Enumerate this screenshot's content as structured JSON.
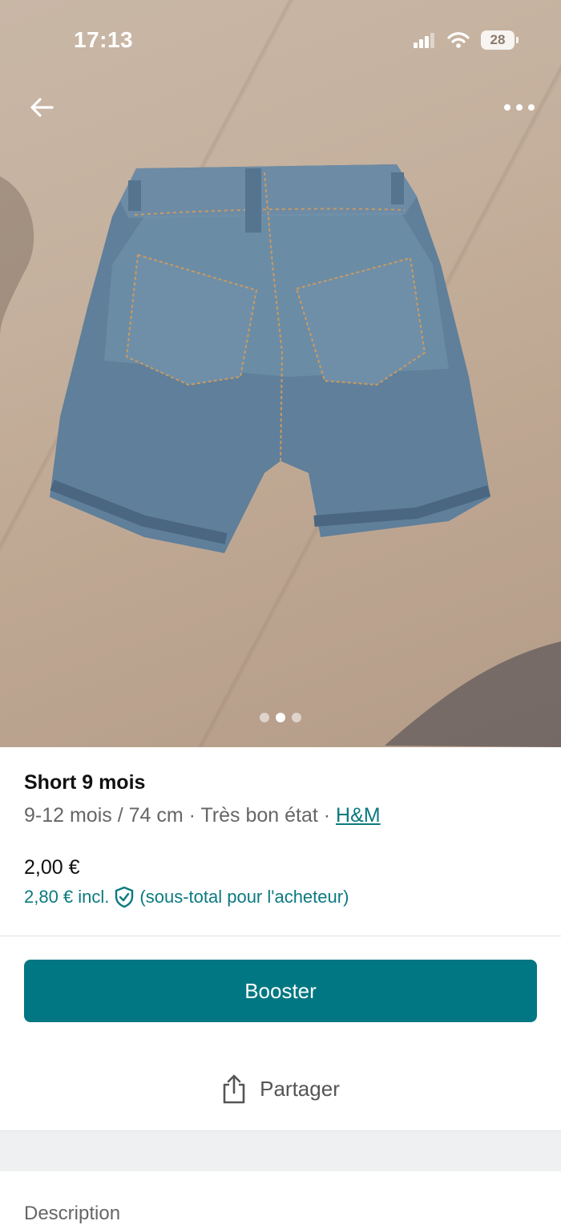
{
  "status_bar": {
    "time": "17:13",
    "battery": "28",
    "icons": [
      "signal-icon",
      "wifi-icon",
      "battery-icon"
    ]
  },
  "nav": {
    "back_icon": "arrow-left-icon",
    "more_icon": "more-horizontal-icon"
  },
  "gallery": {
    "image_count": 3,
    "active_index": 1
  },
  "item": {
    "title": "Short 9 mois",
    "size": "9-12 mois / 74 cm",
    "separator": " · ",
    "condition": "Très bon état",
    "brand": "H&M",
    "price": "2,00 €",
    "buyer_price": "2,80 € incl.",
    "buyer_note": "(sous-total pour l'acheteur)",
    "protection_icon": "shield-check-icon"
  },
  "actions": {
    "booster_label": "Booster",
    "share_label": "Partager",
    "share_icon": "share-icon"
  },
  "sections": {
    "description_label": "Description"
  },
  "colors": {
    "accent": "#007782",
    "link": "#0b7a80"
  }
}
